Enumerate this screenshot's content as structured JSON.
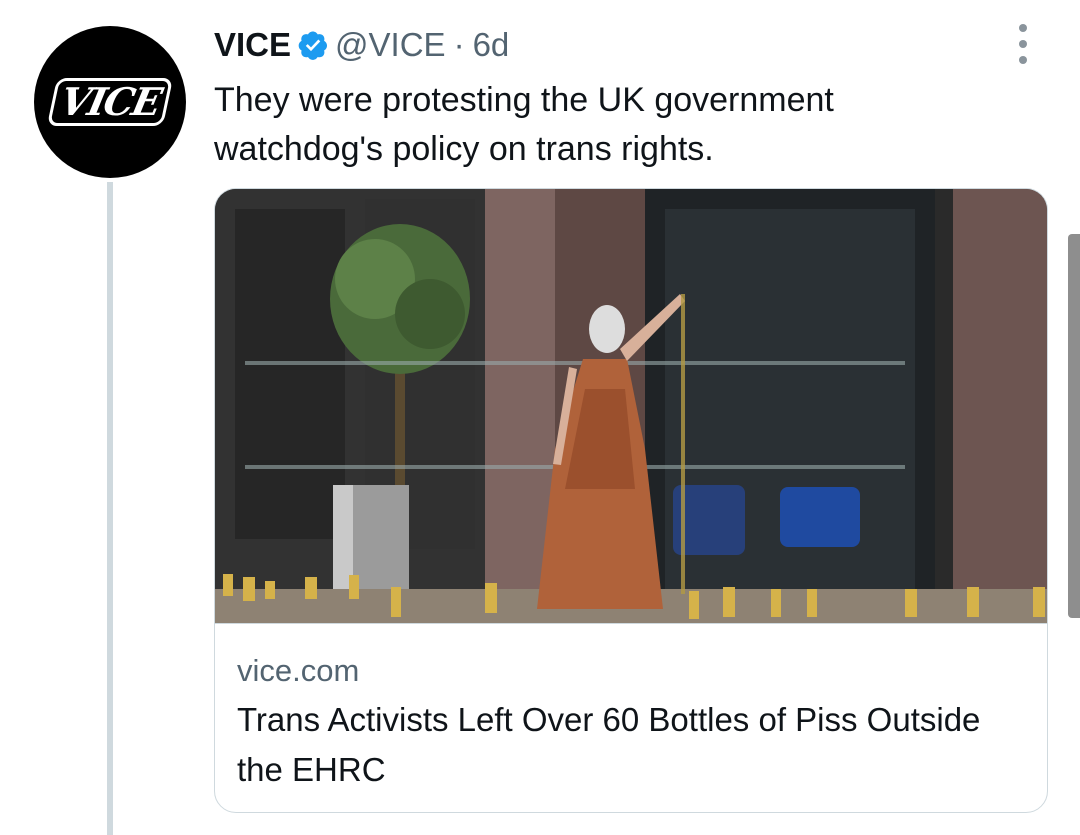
{
  "author": {
    "display_name": "VICE",
    "handle": "@VICE",
    "separator": "·",
    "time": "6d",
    "verified": true,
    "avatar_logo": "VICE"
  },
  "tweet": {
    "text": "They were protesting the UK government watchdog's policy on trans rights."
  },
  "card": {
    "domain": "vice.com",
    "title": "Trans Activists Left Over 60 Bottles of Piss Outside the EHRC",
    "image_icon": "photo-protester-pouring-bottle"
  },
  "colors": {
    "verified": "#1d9bf0",
    "secondary_text": "#536471",
    "thread_line": "#cfd9de"
  }
}
